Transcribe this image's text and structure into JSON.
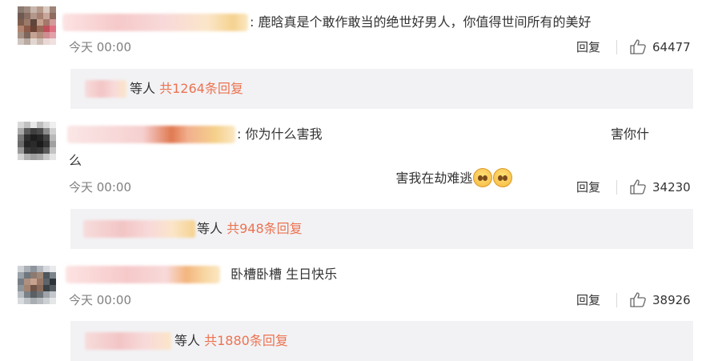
{
  "comments": [
    {
      "text": ": 鹿晗真是个敢作敢当的绝世好男人，你值得世间所有的美好",
      "time": "今天 00:00",
      "reply_label": "回复",
      "like_count": "64477",
      "replies_suffix": "等人",
      "replies_link": "共1264条回复"
    },
    {
      "text_line1": ": 你为什么害我",
      "text_line1_tail": "害你什",
      "text_line2_head": "么",
      "text_line2_tail": "害我在劫难逃",
      "emoji": [
        "cry-emoji",
        "cry-emoji"
      ],
      "time": "今天 00:00",
      "reply_label": "回复",
      "like_count": "34230",
      "replies_suffix": "等人",
      "replies_link": "共948条回复"
    },
    {
      "text": "卧槽卧槽 生日快乐",
      "time": "今天 00:00",
      "reply_label": "回复",
      "like_count": "38926",
      "replies_suffix": "等人",
      "replies_link": "共1880条回复"
    }
  ],
  "colors": {
    "link": "#eb7350",
    "muted": "#808080",
    "reply_bg": "#f2f2f5"
  },
  "icons": {
    "like": "thumbs-up-icon"
  }
}
